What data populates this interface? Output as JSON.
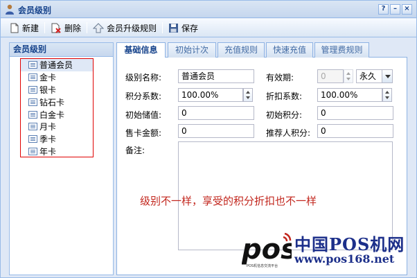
{
  "window": {
    "title": "会员级别",
    "tools": [
      "?",
      "–",
      "×"
    ]
  },
  "toolbar": {
    "new_label": "新建",
    "delete_label": "删除",
    "upgrade_label": "会员升级规则",
    "save_label": "保存"
  },
  "left": {
    "header": "会员级别",
    "items": [
      {
        "label": "普通会员"
      },
      {
        "label": "金卡"
      },
      {
        "label": "银卡"
      },
      {
        "label": "钻石卡"
      },
      {
        "label": "白金卡"
      },
      {
        "label": "月卡"
      },
      {
        "label": "季卡"
      },
      {
        "label": "年卡"
      }
    ]
  },
  "tabs": [
    {
      "label": "基础信息"
    },
    {
      "label": "初始计次"
    },
    {
      "label": "充值规则"
    },
    {
      "label": "快速充值"
    },
    {
      "label": "管理费规则"
    }
  ],
  "form": {
    "level_name_label": "级别名称:",
    "level_name_value": "普通会员",
    "validity_label": "有效期:",
    "validity_value": "0",
    "validity_unit": "永久",
    "points_ratio_label": "积分系数:",
    "points_ratio_value": "100.00%",
    "discount_ratio_label": "折扣系数:",
    "discount_ratio_value": "100.00%",
    "initial_balance_label": "初始储值:",
    "initial_balance_value": "0",
    "initial_points_label": "初始积分:",
    "initial_points_value": "0",
    "card_price_label": "售卡金额:",
    "card_price_value": "0",
    "referrer_points_label": "推荐人积分:",
    "referrer_points_value": "0",
    "remarks_label": "备注:"
  },
  "annotation": "级别不一样，享受的积分折扣也不一样",
  "watermark": {
    "logo_text": "pos",
    "title": "中国POS机网",
    "url": "www.pos168.net",
    "small_text": "POS机信息交流平台"
  },
  "colors": {
    "accent": "#15428b",
    "panel_bg": "#dfe8f6",
    "border": "#99bbe8",
    "annotation": "#c2261d",
    "highlight": "#e00000"
  }
}
